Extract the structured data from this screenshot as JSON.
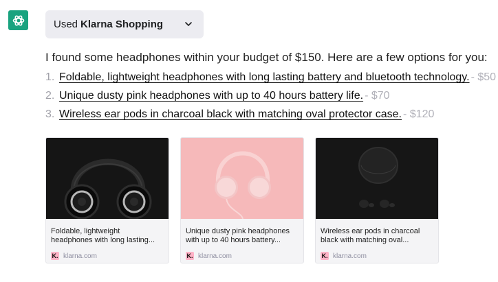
{
  "plugin": {
    "used_label": "Used",
    "name": "Klarna Shopping"
  },
  "message": {
    "intro": "I found some headphones within your budget of $150. Here are a few options for you:",
    "items": [
      {
        "num": "1.",
        "title": "Foldable, lightweight headphones with long lasting battery and bluetooth technology.",
        "price": "- $50"
      },
      {
        "num": "2.",
        "title": "Unique dusty pink headphones with up to 40 hours battery life.",
        "price": "- $70"
      },
      {
        "num": "3.",
        "title": "Wireless ear pods in charcoal black with matching oval protector case.",
        "price": "- $120"
      }
    ]
  },
  "cards": [
    {
      "title": "Foldable, lightweight headphones with long lasting...",
      "source": "klarna.com",
      "logo": "K."
    },
    {
      "title": "Unique dusty pink headphones with up to 40 hours battery...",
      "source": "klarna.com",
      "logo": "K."
    },
    {
      "title": "Wireless ear pods in charcoal black with matching oval...",
      "source": "klarna.com",
      "logo": "K."
    }
  ],
  "colors": {
    "avatar": "#19a37f",
    "pill": "#ececf1",
    "klarna_pink": "#ffb3c7"
  }
}
